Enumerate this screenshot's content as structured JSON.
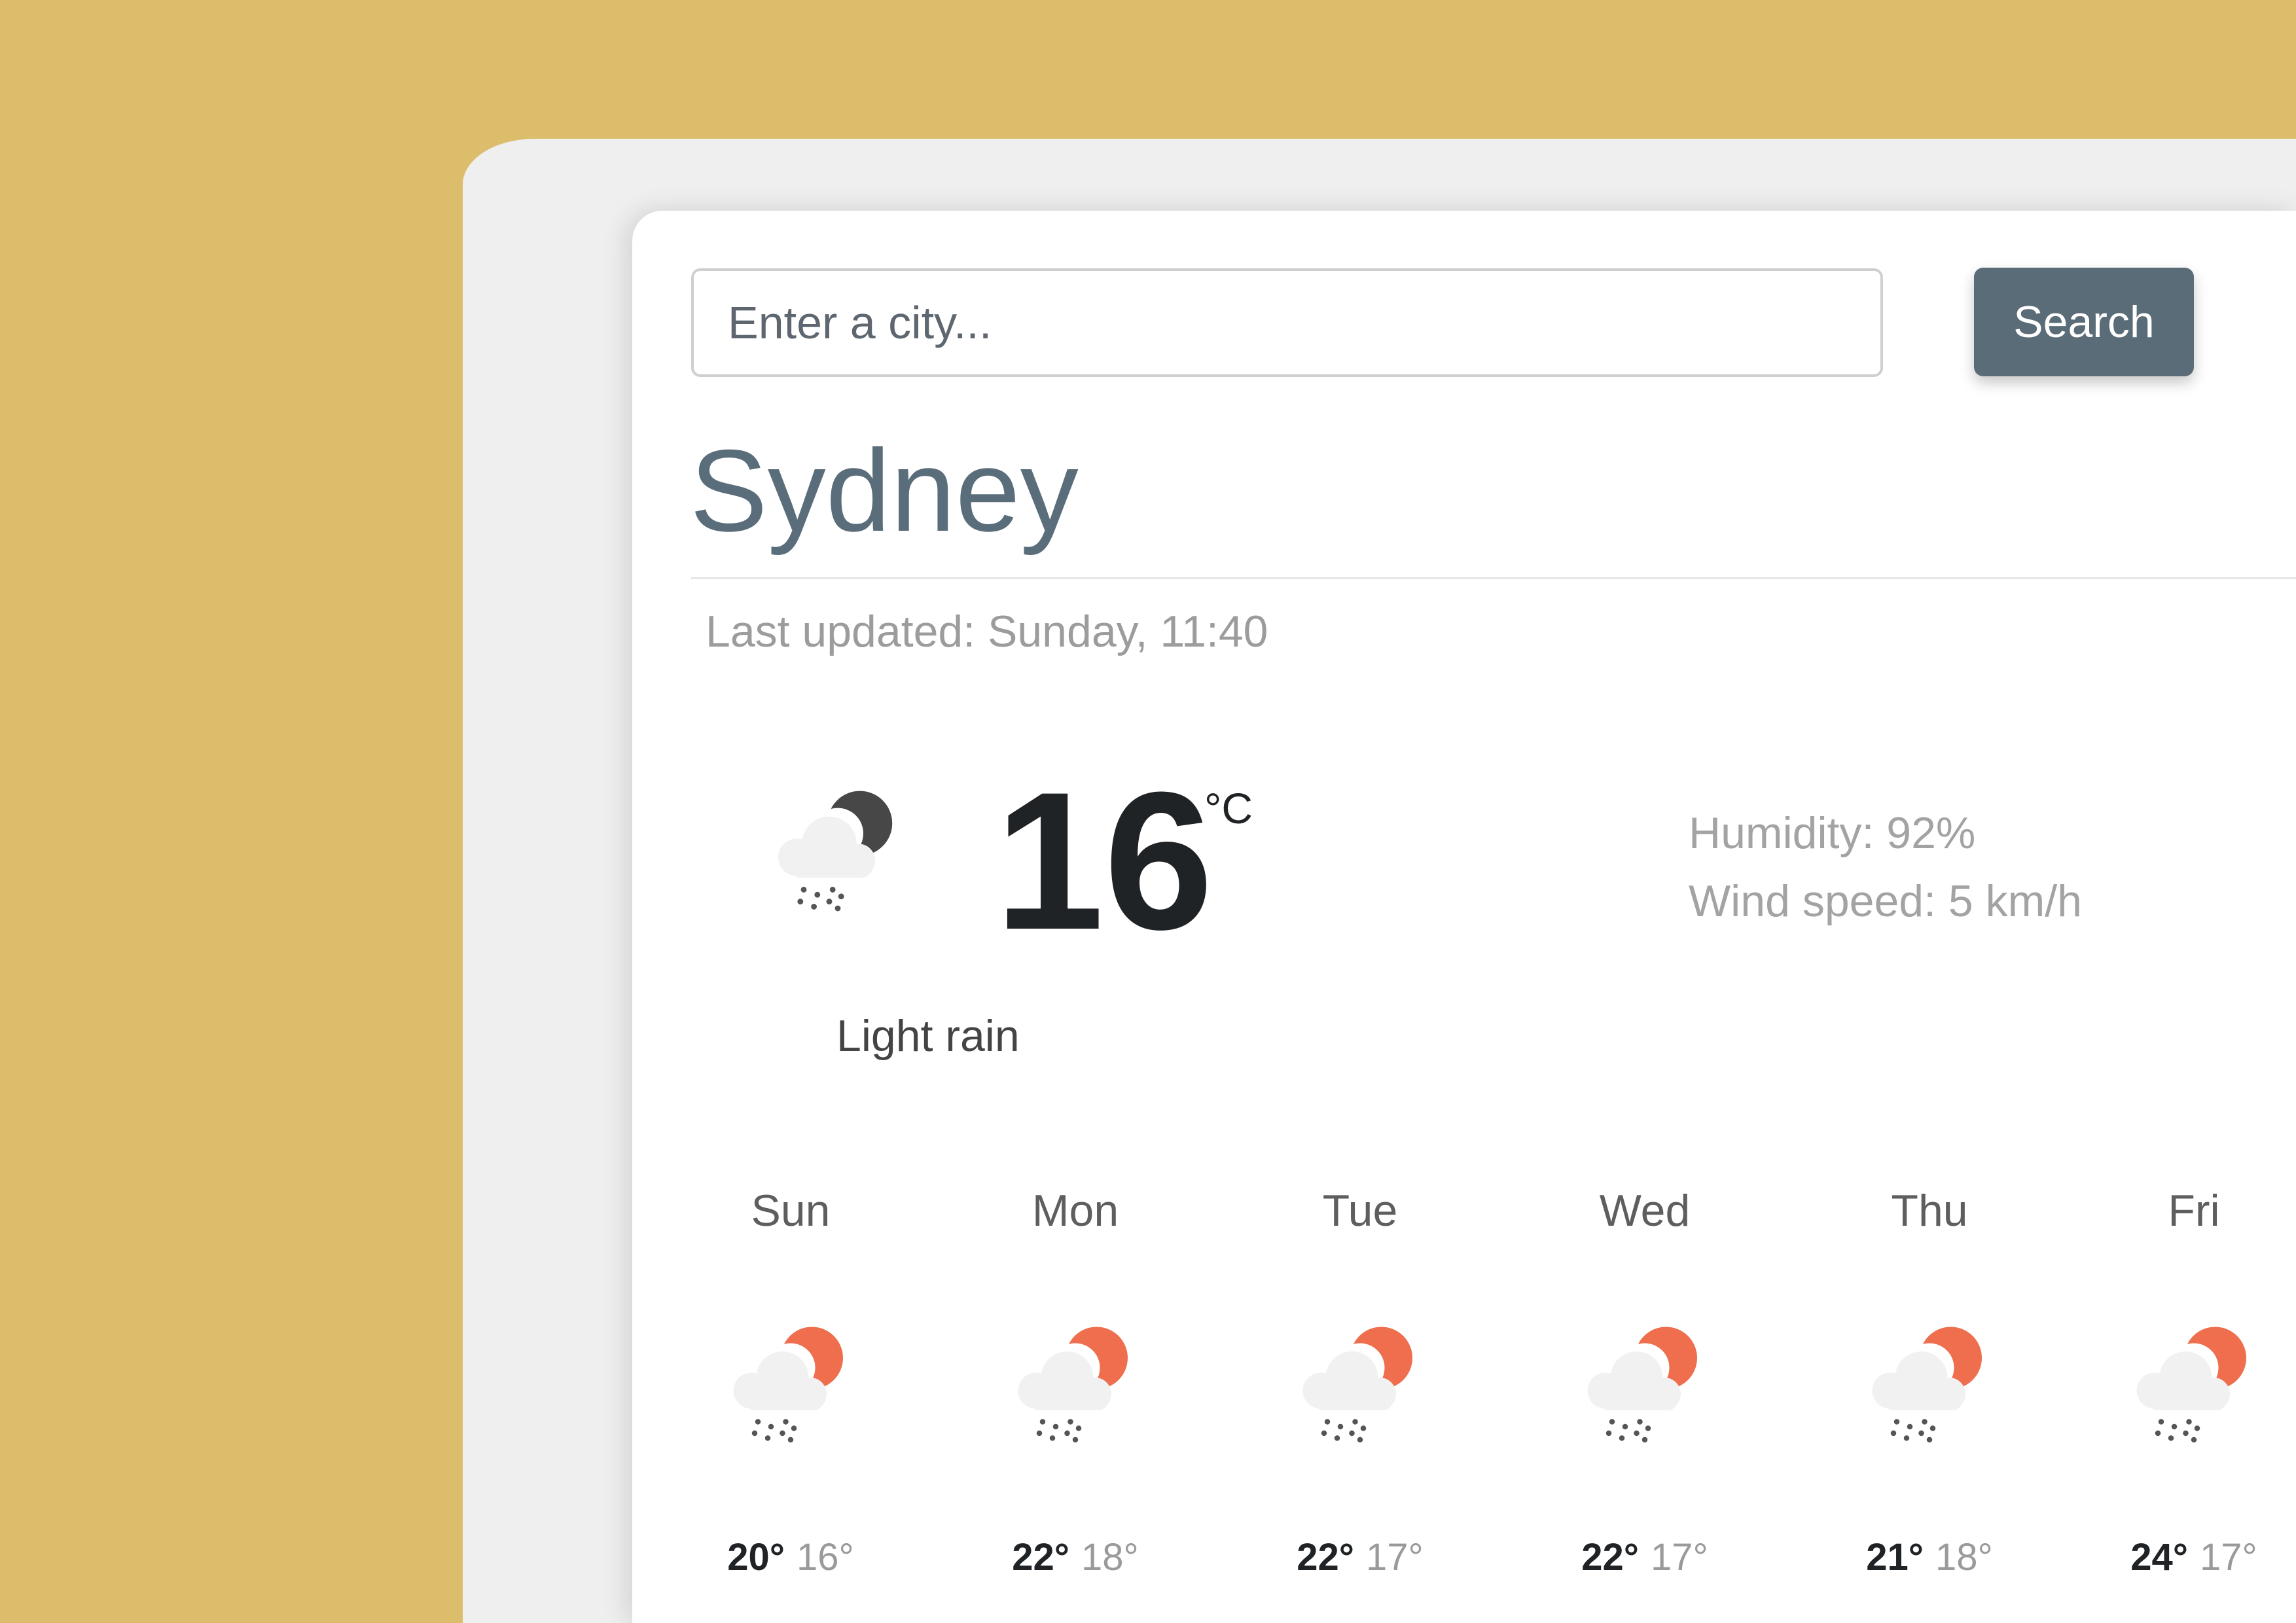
{
  "search": {
    "placeholder": "Enter a city...",
    "button_label": "Search"
  },
  "current": {
    "city": "Sydney",
    "last_updated": "Last updated: Sunday, 11:40",
    "temperature": "16",
    "unit": "°C",
    "humidity": "Humidity: 92%",
    "wind_speed": "Wind speed: 5 km/h",
    "condition": "Light rain",
    "icon": "night-cloud-rain-icon"
  },
  "forecast": [
    {
      "day": "Sun",
      "max": "20°",
      "min": "16°",
      "icon": "cloud-sun-rain-icon"
    },
    {
      "day": "Mon",
      "max": "22°",
      "min": "18°",
      "icon": "cloud-sun-rain-icon"
    },
    {
      "day": "Tue",
      "max": "22°",
      "min": "17°",
      "icon": "cloud-sun-rain-icon"
    },
    {
      "day": "Wed",
      "max": "22°",
      "min": "17°",
      "icon": "cloud-sun-rain-icon"
    },
    {
      "day": "Thu",
      "max": "21°",
      "min": "18°",
      "icon": "cloud-sun-rain-icon"
    },
    {
      "day": "Fri",
      "max": "24°",
      "min": "17°",
      "icon": "cloud-sun-rain-icon"
    }
  ],
  "colors": {
    "background": "#DCBD6B",
    "accent": "#5A6C78",
    "sun": "#EE6E4D",
    "moon": "#474747"
  }
}
